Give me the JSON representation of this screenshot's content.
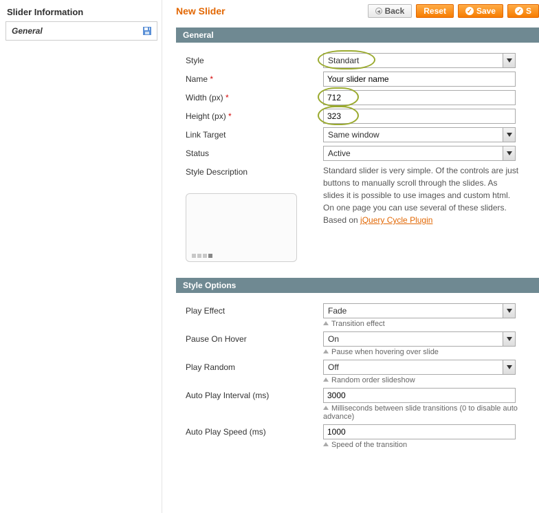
{
  "sidebar": {
    "title": "Slider Information",
    "items": [
      {
        "label": "General"
      }
    ]
  },
  "header": {
    "title": "New Slider",
    "back": "Back",
    "reset": "Reset",
    "save": "Save",
    "save_cont": "S"
  },
  "section_general": "General",
  "section_style": "Style Options",
  "fields": {
    "style": {
      "label": "Style",
      "value": "Standart"
    },
    "name": {
      "label": "Name",
      "value": "Your slider name"
    },
    "width": {
      "label": "Width (px)",
      "value": "712"
    },
    "height": {
      "label": "Height (px)",
      "value": "323"
    },
    "link_target": {
      "label": "Link Target",
      "value": "Same window"
    },
    "status": {
      "label": "Status",
      "value": "Active"
    },
    "style_desc_label": "Style Description",
    "style_desc_text": "Standard slider is very simple. Of the controls are just buttons to manually scroll through the slides. As slides it is possible to use images and custom html. On one page you can use several of these sliders. Based on ",
    "style_desc_link": "jQuery Cycle Plugin",
    "play_effect": {
      "label": "Play Effect",
      "value": "Fade",
      "hint": "Transition effect"
    },
    "pause_hover": {
      "label": "Pause On Hover",
      "value": "On",
      "hint": "Pause when hovering over slide"
    },
    "play_random": {
      "label": "Play Random",
      "value": "Off",
      "hint": "Random order slideshow"
    },
    "auto_interval": {
      "label": "Auto Play Interval (ms)",
      "value": "3000",
      "hint": "Milliseconds between slide transitions (0 to disable auto advance)"
    },
    "auto_speed": {
      "label": "Auto Play Speed (ms)",
      "value": "1000",
      "hint": "Speed of the transition"
    }
  }
}
